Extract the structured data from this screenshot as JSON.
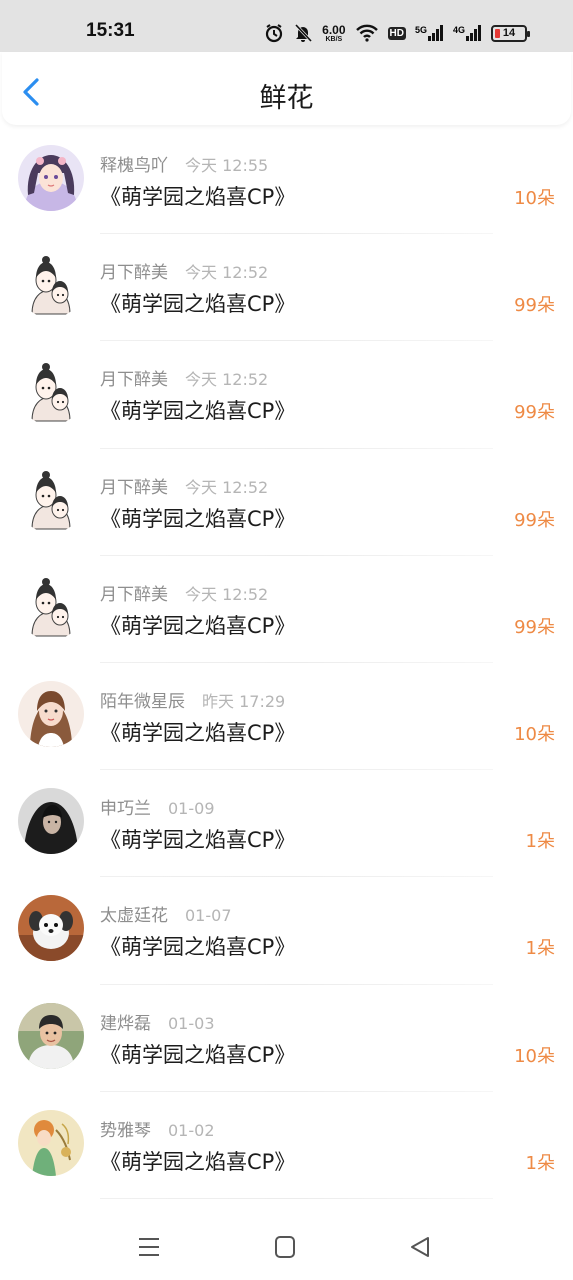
{
  "status_bar": {
    "time": "15:31",
    "net_speed_value": "6.00",
    "net_speed_unit": "KB/S",
    "hd_label": "HD",
    "signal1_label": "5G",
    "signal2_label": "4G",
    "battery_level": "14"
  },
  "header": {
    "title": "鲜花"
  },
  "rows": [
    {
      "name": "释槐鸟吖",
      "time": "今天 12:55",
      "book": "《萌学园之焰喜CP》",
      "count": "10朵",
      "avatar": "anime-girl"
    },
    {
      "name": "月下醉美",
      "time": "今天 12:52",
      "book": "《萌学园之焰喜CP》",
      "count": "99朵",
      "avatar": "cartoon-couple"
    },
    {
      "name": "月下醉美",
      "time": "今天 12:52",
      "book": "《萌学园之焰喜CP》",
      "count": "99朵",
      "avatar": "cartoon-couple"
    },
    {
      "name": "月下醉美",
      "time": "今天 12:52",
      "book": "《萌学园之焰喜CP》",
      "count": "99朵",
      "avatar": "cartoon-couple"
    },
    {
      "name": "月下醉美",
      "time": "今天 12:52",
      "book": "《萌学园之焰喜CP》",
      "count": "99朵",
      "avatar": "cartoon-couple"
    },
    {
      "name": "陌年微星辰",
      "time": "昨天 17:29",
      "book": "《萌学园之焰喜CP》",
      "count": "10朵",
      "avatar": "girl-photo"
    },
    {
      "name": "申巧兰",
      "time": "01-09",
      "book": "《萌学园之焰喜CP》",
      "count": "1朵",
      "avatar": "hooded-person"
    },
    {
      "name": "太虚廷花",
      "time": "01-07",
      "book": "《萌学园之焰喜CP》",
      "count": "1朵",
      "avatar": "puppy"
    },
    {
      "name": "建烨磊",
      "time": "01-03",
      "book": "《萌学园之焰喜CP》",
      "count": "10朵",
      "avatar": "boy-photo"
    },
    {
      "name": "势雅琴",
      "time": "01-02",
      "book": "《萌学园之焰喜CP》",
      "count": "1朵",
      "avatar": "illustration"
    }
  ],
  "colors": {
    "accent": "#2b8ef0",
    "count": "#ee8a45",
    "name": "#8e8e8e",
    "time": "#b5b5b5"
  },
  "nav": [
    "menu-icon",
    "home-icon",
    "back-icon"
  ]
}
